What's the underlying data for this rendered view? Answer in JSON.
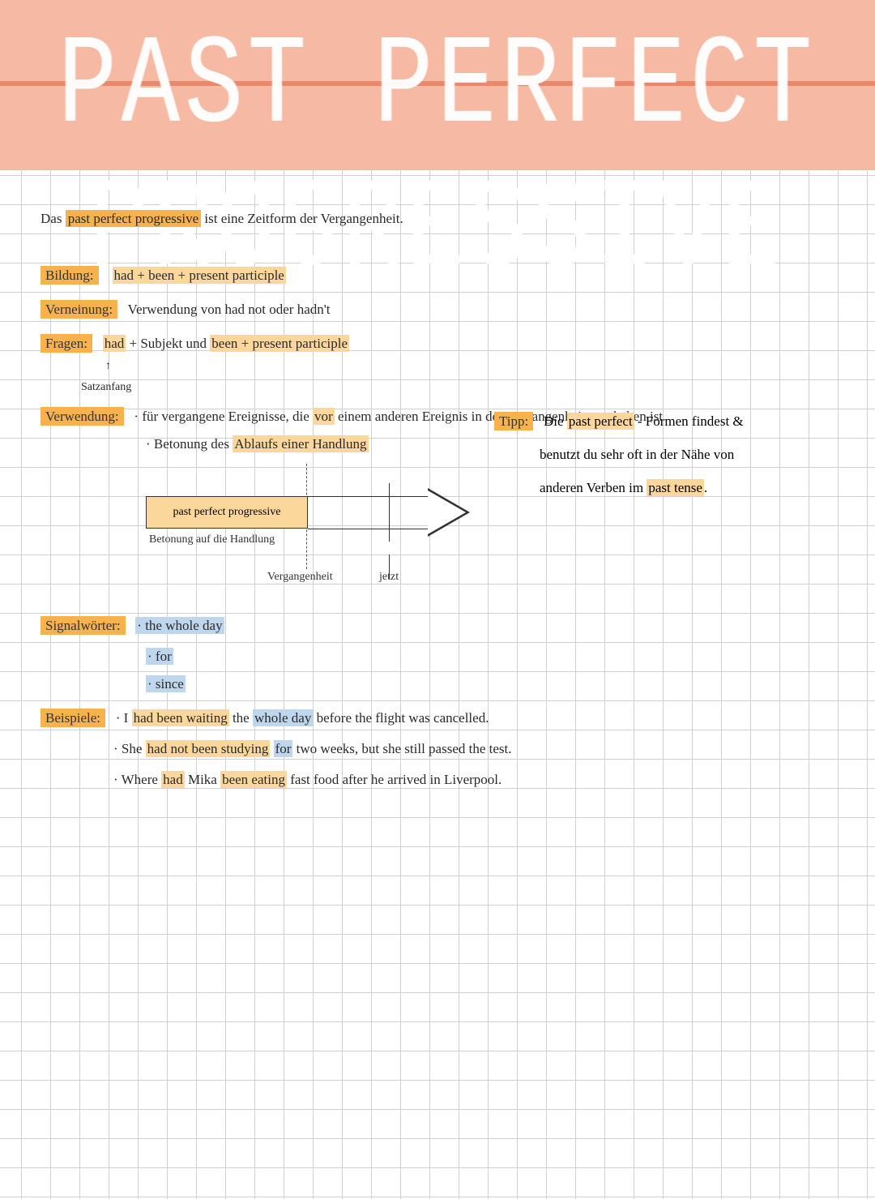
{
  "title": "PAST PERFECT PROGRESSIVE",
  "intro": {
    "pre": "Das ",
    "hl": "past perfect progressive",
    "post": " ist eine Zeitform der Vergangenheit."
  },
  "bildung": {
    "label": "Bildung:",
    "text": "had + been + present participle"
  },
  "verneinung": {
    "label": "Verneinung:",
    "text": "Verwendung von had not oder hadn't"
  },
  "fragen": {
    "label": "Fragen:",
    "p1": "had",
    "p2": " + Subjekt und ",
    "p3": "been + present participle",
    "note_arrow": "↑",
    "note": "Satzanfang"
  },
  "verwendung": {
    "label": "Verwendung:",
    "b1_pre": "· für vergangene Ereignisse, die ",
    "b1_hl": "vor",
    "b1_post": " einem anderen Ereignis in der Vergangenheit geschehen ist",
    "b2_pre": "· Betonung des ",
    "b2_hl": "Ablaufs einer Handlung"
  },
  "diagram": {
    "box": "past perfect progressive",
    "caption": "Betonung auf die Handlung",
    "past": "Vergangenheit",
    "now": "jetzt"
  },
  "tipp": {
    "label": "Tipp:",
    "l1a": "Die ",
    "l1b": "past perfect",
    "l1c": " - Formen findest &",
    "l2": "benutzt du sehr oft in der Nähe von",
    "l3a": "anderen Verben im ",
    "l3b": "past tense",
    "l3c": "."
  },
  "signal": {
    "label": "Signalwörter:",
    "s1": "· the whole day",
    "s2": "· for",
    "s3": "· since"
  },
  "beispiele": {
    "label": "Beispiele:",
    "e1": {
      "a": "· I ",
      "b": "had been waiting",
      "c": " the ",
      "d": "whole day",
      "e": " before the flight was cancelled."
    },
    "e2": {
      "a": "· She ",
      "b": "had not been studying",
      "c": " ",
      "d": "for",
      "e": " two weeks, but she still passed the test."
    },
    "e3": {
      "a": "· Where ",
      "b": "had",
      "c": " Mika ",
      "d": "been eating",
      "e": " fast food after he arrived in Liverpool."
    }
  }
}
